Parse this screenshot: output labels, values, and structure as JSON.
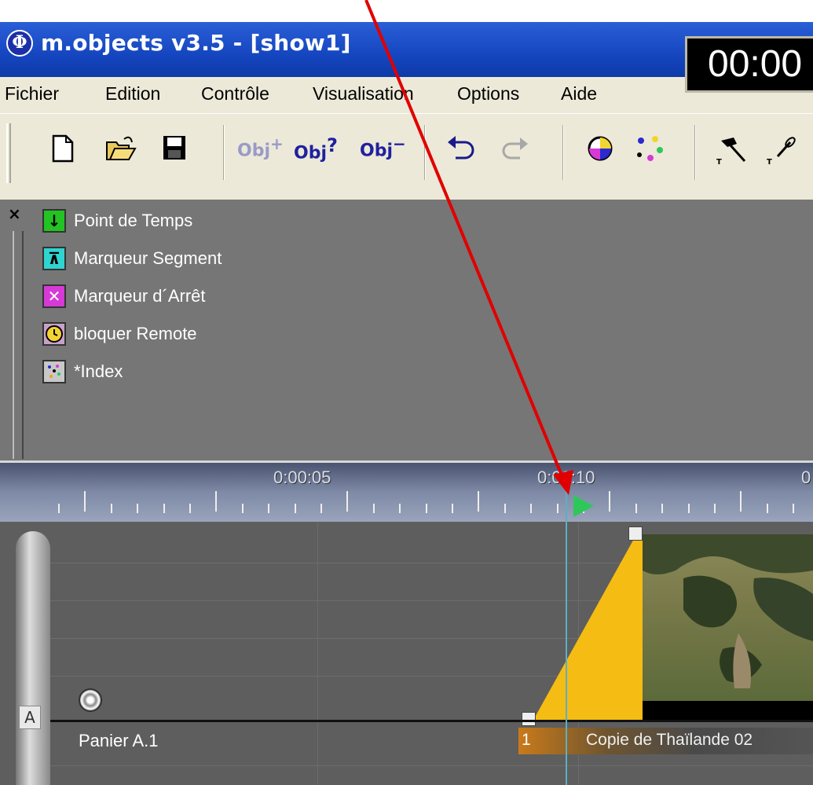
{
  "window": {
    "title": "m.objects v3.5 - [show1]",
    "app_icon": "m-objects-logo-icon",
    "timecode": "00:00"
  },
  "menu": {
    "items": [
      "Fichier",
      "Edition",
      "Contrôle",
      "Visualisation",
      "Options",
      "Aide"
    ]
  },
  "toolbar": {
    "icons": [
      "new-document-icon",
      "open-folder-icon",
      "save-disk-icon",
      "add-object-icon",
      "object-info-icon",
      "remove-object-icon",
      "undo-icon",
      "redo-icon",
      "color-wheel-icon",
      "color-scatter-icon",
      "hammer-icon",
      "link-tool-icon"
    ],
    "obj_label": "Obj"
  },
  "palette": {
    "close": "×",
    "items": [
      {
        "label": "Point de Temps",
        "icon": "down-arrow-icon",
        "color": "#22c322"
      },
      {
        "label": "Marqueur Segment",
        "icon": "segment-marker-icon",
        "color": "#2fd4d0"
      },
      {
        "label": "Marqueur d´Arrêt",
        "icon": "stop-cross-icon",
        "color": "#d63ad6"
      },
      {
        "label": "bloquer Remote",
        "icon": "clock-icon",
        "color": "#f2d431"
      },
      {
        "label": "*Index",
        "icon": "index-icon",
        "color": "#c8c8c8"
      }
    ]
  },
  "timeline": {
    "ruler_labels": [
      "0:00:05",
      "0:00:10",
      "0"
    ],
    "track_letter": "A",
    "track_name": "Panier A.1",
    "clip_number": "1",
    "clip_caption": "Copie de Thaïlande 02"
  },
  "annotation": {
    "arrow_color": "#e00000"
  }
}
